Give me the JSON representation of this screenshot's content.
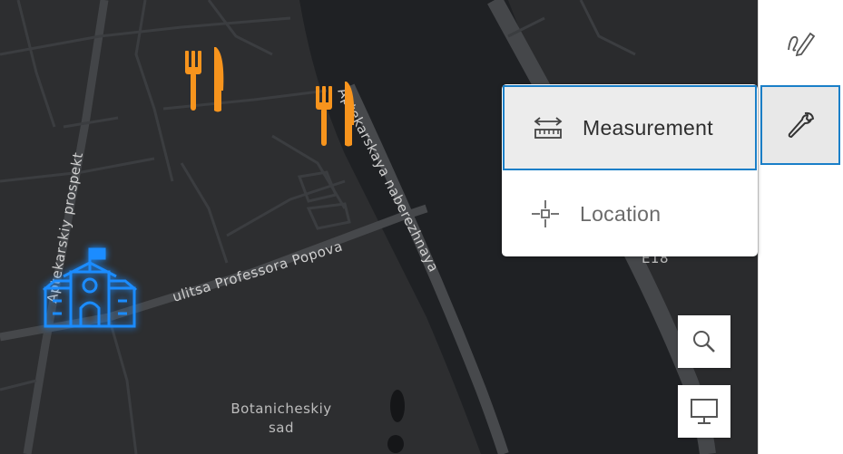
{
  "map": {
    "road_labels": [
      "Aptekarskiy prospekt",
      "ulitsa Professora Popova",
      "Aptekarskaya naberezhnaya"
    ],
    "area_label_line1": "Botanicheskiy",
    "area_label_line2": "sad",
    "route_shield": "E18",
    "poi": {
      "restaurant_color": "#f7941d",
      "school_color": "#1b8cff"
    }
  },
  "toolbar": {
    "sketch_icon": "sketch-pen-icon",
    "tools_icon": "wrench-icon",
    "active_accent": "#1a7fc8"
  },
  "menu": {
    "items": [
      {
        "label": "Measurement",
        "icon": "ruler-measure-icon",
        "selected": true
      },
      {
        "label": "Location",
        "icon": "crosshair-location-icon",
        "selected": false
      }
    ]
  },
  "map_controls": {
    "search_icon": "search-icon",
    "screen_icon": "monitor-icon"
  }
}
